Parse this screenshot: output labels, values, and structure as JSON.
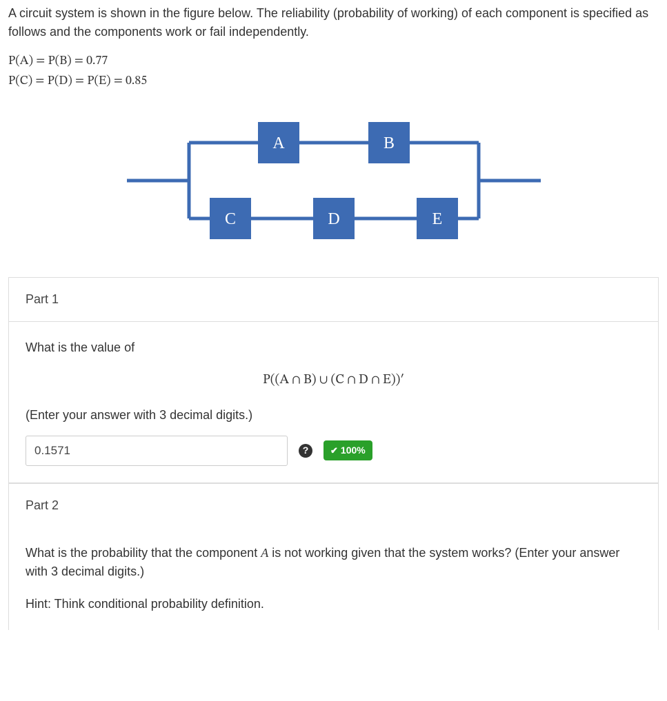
{
  "intro": "A circuit system is shown in the figure below. The reliability (probability of working) of each component is specified as follows and the components work or fail independently.",
  "eq1": "P(A) = P(B) = 0.77",
  "eq2": "P(C) = P(D) = P(E) = 0.85",
  "diagram": {
    "nodes": [
      "A",
      "B",
      "C",
      "D",
      "E"
    ],
    "topology": "two parallel branches: top branch A→B in series; bottom branch C→D→E in series"
  },
  "part1": {
    "title": "Part 1",
    "prompt": "What is the value of",
    "expression": "P((A ∩ B) ∪ (C ∩ D ∩ E))′",
    "instruction": "(Enter your answer with 3 decimal digits.)",
    "answer_value": "0.1571",
    "score_label": "100%"
  },
  "part2": {
    "title": "Part 2",
    "prompt_prefix": "What is the probability that the component ",
    "prompt_component": "A",
    "prompt_suffix": " is not working given that the system works? (Enter your answer with 3 decimal digits.)",
    "hint": "Hint: Think conditional probability definition."
  }
}
